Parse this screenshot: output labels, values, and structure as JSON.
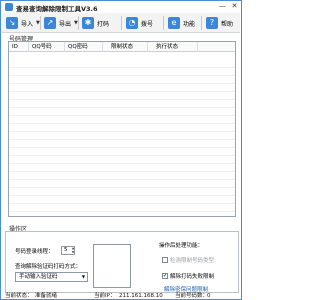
{
  "window": {
    "title": "查易查询解除限制工具V3.6",
    "minimize_glyph": "—",
    "close_glyph": "✕"
  },
  "toolbar": {
    "items": [
      {
        "label": "导入",
        "icon": "import-icon",
        "color": "#3b86d8",
        "glyph": "↘",
        "has_caret": true
      },
      {
        "label": "导出",
        "icon": "export-icon",
        "color": "#3b86d8",
        "glyph": "↗",
        "has_caret": true
      },
      {
        "label": "打码",
        "icon": "star-icon",
        "color": "#3b86d8",
        "glyph": "✱",
        "has_caret": false
      },
      {
        "label": "拨号",
        "icon": "clock-icon",
        "color": "#3b86d8",
        "glyph": "◔",
        "has_caret": false
      },
      {
        "label": "功能",
        "icon": "function-icon",
        "color": "#3b86d8",
        "glyph": "e",
        "has_caret": false
      },
      {
        "label": "帮助",
        "icon": "help-icon",
        "color": "#3b86d8",
        "glyph": "?",
        "has_caret": false
      }
    ],
    "caret_glyph": "▼"
  },
  "account_panel": {
    "title": "号码管理",
    "columns": [
      "ID",
      "QQ号码",
      "QQ密码",
      "限制状态",
      "执行状态"
    ]
  },
  "ops_panel": {
    "title": "操作区",
    "login_delay_label": "号码登录线程：",
    "login_delay_value": "5",
    "captcha_label": "查询解除验证码打码方式：",
    "captcha_option": "手动输入验证码",
    "post_process_label": "操作后处理功能：",
    "checkbox_detect": {
      "label": "检测限制号码类型",
      "checked": false,
      "disabled": true
    },
    "checkbox_unfreeze": {
      "label": "解除打码失败限制",
      "checked": true,
      "disabled": false
    },
    "link": "解除密保问题限制"
  },
  "statusbar": {
    "status_label": "当前状态：",
    "status_value": "准备就绪",
    "ip_label": "当前IP：",
    "ip_value": "211.161.168.10",
    "count_label": "当前号码数：",
    "count_value": "0"
  }
}
